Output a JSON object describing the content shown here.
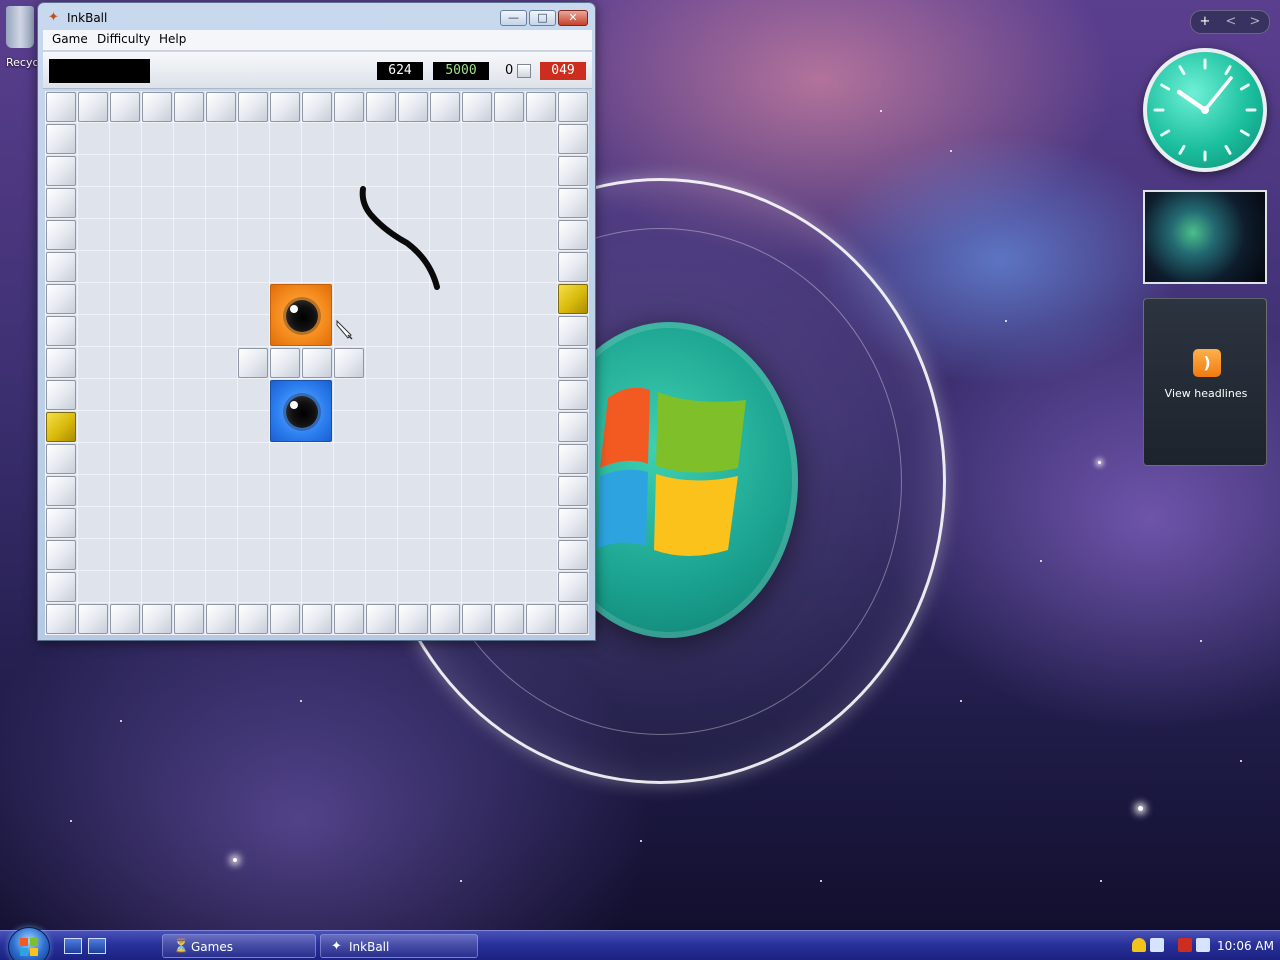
{
  "desktop": {
    "recycle_bin_label": "Recycle Bin"
  },
  "window": {
    "title": "InkBall",
    "menu": [
      "Game",
      "Difficulty",
      "Help"
    ],
    "controls": {
      "minimize": "minimize-icon",
      "maximize": "maximize-icon",
      "close": "close-icon"
    }
  },
  "scoreboard": {
    "score": "624",
    "goal": "5000",
    "balls_remaining": "0",
    "timer": "049"
  },
  "board": {
    "grid_size": 17,
    "gold_walls": [
      "right-6",
      "left-10"
    ],
    "holes": [
      {
        "color": "orange",
        "hex": "#f48a1c"
      },
      {
        "color": "blue",
        "hex": "#2c7ef0"
      }
    ],
    "ink_stroke_color": "#000000"
  },
  "gadgets": {
    "sidebar_controls": [
      "+",
      "<",
      ">"
    ],
    "clock": "analog clock",
    "slideshow": "slide show",
    "feeds_label": "View headlines"
  },
  "taskbar": {
    "start": "start-orb",
    "tasks": [
      {
        "label": "Games",
        "icon": "games-icon"
      },
      {
        "label": "InkBall",
        "icon": "inkball-icon"
      }
    ],
    "time": "10:06 AM"
  },
  "colors": {
    "taskbar": "#28319a",
    "window_frame": "#b6cae3",
    "score_red": "#cc2d1f",
    "score_green": "#9fe08a"
  }
}
